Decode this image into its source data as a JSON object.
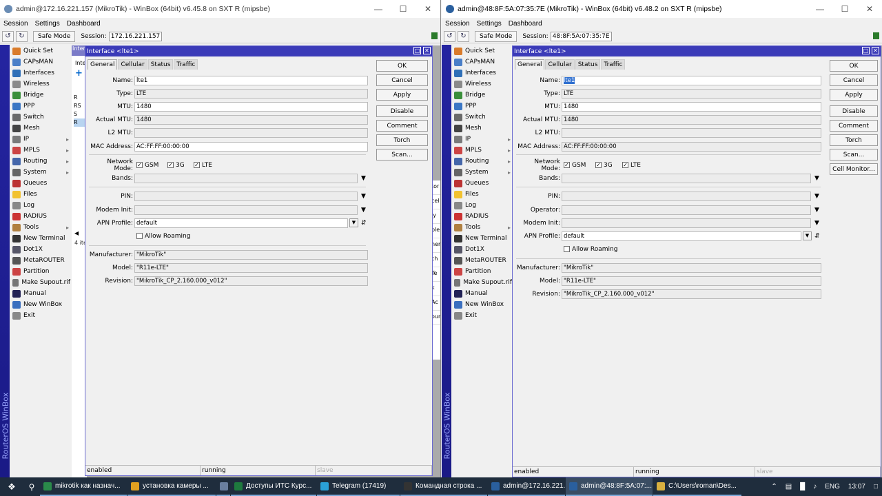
{
  "window1": {
    "title": "admin@172.16.221.157 (MikroTik) - WinBox (64bit) v6.45.8 on SXT R (mipsbe)",
    "session_value": "172.16.221.157"
  },
  "window2": {
    "title": "admin@48:8F:5A:07:35:7E (MikroTik) - WinBox (64bit) v6.48.2 on SXT R (mipsbe)",
    "session_value": "48:8F:5A:07:35:7E"
  },
  "menubar": {
    "session": "Session",
    "settings": "Settings",
    "dashboard": "Dashboard"
  },
  "toolbar": {
    "safe_mode": "Safe Mode",
    "session_label": "Session:"
  },
  "brand": "RouterOS WinBox",
  "sidemenu": [
    {
      "label": "Quick Set",
      "arrow": false
    },
    {
      "label": "CAPsMAN",
      "arrow": false
    },
    {
      "label": "Interfaces",
      "arrow": false
    },
    {
      "label": "Wireless",
      "arrow": false
    },
    {
      "label": "Bridge",
      "arrow": false
    },
    {
      "label": "PPP",
      "arrow": false
    },
    {
      "label": "Switch",
      "arrow": false
    },
    {
      "label": "Mesh",
      "arrow": false
    },
    {
      "label": "IP",
      "arrow": true
    },
    {
      "label": "MPLS",
      "arrow": true
    },
    {
      "label": "Routing",
      "arrow": true
    },
    {
      "label": "System",
      "arrow": true
    },
    {
      "label": "Queues",
      "arrow": false
    },
    {
      "label": "Files",
      "arrow": false
    },
    {
      "label": "Log",
      "arrow": false
    },
    {
      "label": "RADIUS",
      "arrow": false
    },
    {
      "label": "Tools",
      "arrow": true
    },
    {
      "label": "New Terminal",
      "arrow": false
    },
    {
      "label": "Dot1X",
      "arrow": false
    },
    {
      "label": "MetaROUTER",
      "arrow": false
    },
    {
      "label": "Partition",
      "arrow": false
    },
    {
      "label": "Make Supout.rif",
      "arrow": false
    },
    {
      "label": "Manual",
      "arrow": false
    },
    {
      "label": "New WinBox",
      "arrow": false
    },
    {
      "label": "Exit",
      "arrow": false
    }
  ],
  "dialog": {
    "title": "Interface <lte1>",
    "tabs": [
      "General",
      "Cellular",
      "Status",
      "Traffic"
    ],
    "labels": {
      "name": "Name:",
      "type": "Type:",
      "mtu": "MTU:",
      "actual_mtu": "Actual MTU:",
      "l2mtu": "L2 MTU:",
      "mac": "MAC Address:",
      "network_mode": "Network Mode:",
      "bands": "Bands:",
      "pin": "PIN:",
      "operator": "Operator:",
      "modem_init": "Modem Init:",
      "apn_profile": "APN Profile:",
      "allow_roaming": "Allow Roaming",
      "manufacturer": "Manufacturer:",
      "model": "Model:",
      "revision": "Revision:"
    },
    "values": {
      "name": "lte1",
      "type": "LTE",
      "mtu": "1480",
      "actual_mtu": "1480",
      "l2mtu": "",
      "mac": "AC:FF:FF:00:00:00",
      "apn_profile": "default",
      "manufacturer": "\"MikroTik\"",
      "model": "\"R11e-LTE\"",
      "revision": "\"MikroTik_CP_2.160.000_v012\""
    },
    "modes": [
      "GSM",
      "3G",
      "LTE"
    ],
    "buttons1": [
      "OK",
      "Cancel",
      "Apply",
      "Disable",
      "Comment",
      "Torch",
      "Scan..."
    ],
    "buttons2": [
      "OK",
      "Cancel",
      "Apply",
      "Disable",
      "Comment",
      "Torch",
      "Scan...",
      "Cell Monitor..."
    ],
    "status": [
      "enabled",
      "running",
      "slave"
    ]
  },
  "bgwin1": {
    "title": "Inter",
    "tab": "Inte",
    "rows": [
      "R",
      "RS",
      "S",
      "R"
    ],
    "footer": "4 ite"
  },
  "bgright1": [
    "tor",
    "cel",
    "ly",
    "ble",
    "ner",
    "ch",
    "Te",
    "k",
    "Ac",
    "oun"
  ],
  "taskbar": {
    "items": [
      "mikrotik как назнач...",
      "установка камеры ...",
      "",
      "Доступы ИТС Курс...",
      "Telegram (17419)",
      "Командная строка ...",
      "admin@172.16.221....",
      "admin@48:8F:5A:07:...",
      "C:\\Users\\roman\\Des..."
    ],
    "lang": "ENG",
    "time": "13:07"
  }
}
